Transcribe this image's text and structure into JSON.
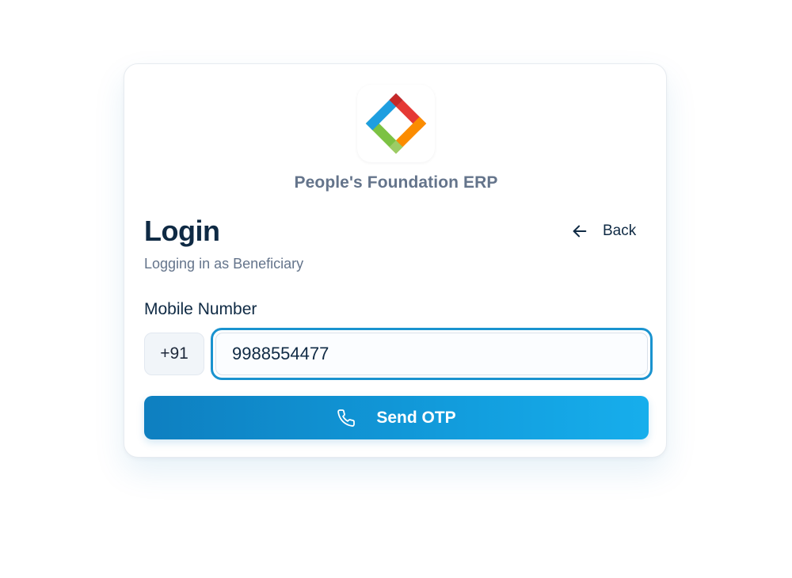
{
  "brand": {
    "org_name": "People's Foundation ERP",
    "logo_colors": [
      "#e53935",
      "#fb8c00",
      "#1e9ee0",
      "#7cc243"
    ]
  },
  "login": {
    "title": "Login",
    "subtitle": "Logging in as Beneficiary",
    "back_label": "Back",
    "back_icon": "arrow-left-icon"
  },
  "mobile": {
    "label": "Mobile Number",
    "country_code": "+91",
    "value": "9988554477",
    "placeholder": ""
  },
  "send_otp": {
    "label": "Send OTP",
    "icon": "phone-icon"
  },
  "colors": {
    "primary": "#129ede",
    "primary_dark": "#0e7fc0",
    "heading": "#0f2a44",
    "muted": "#64748b"
  }
}
